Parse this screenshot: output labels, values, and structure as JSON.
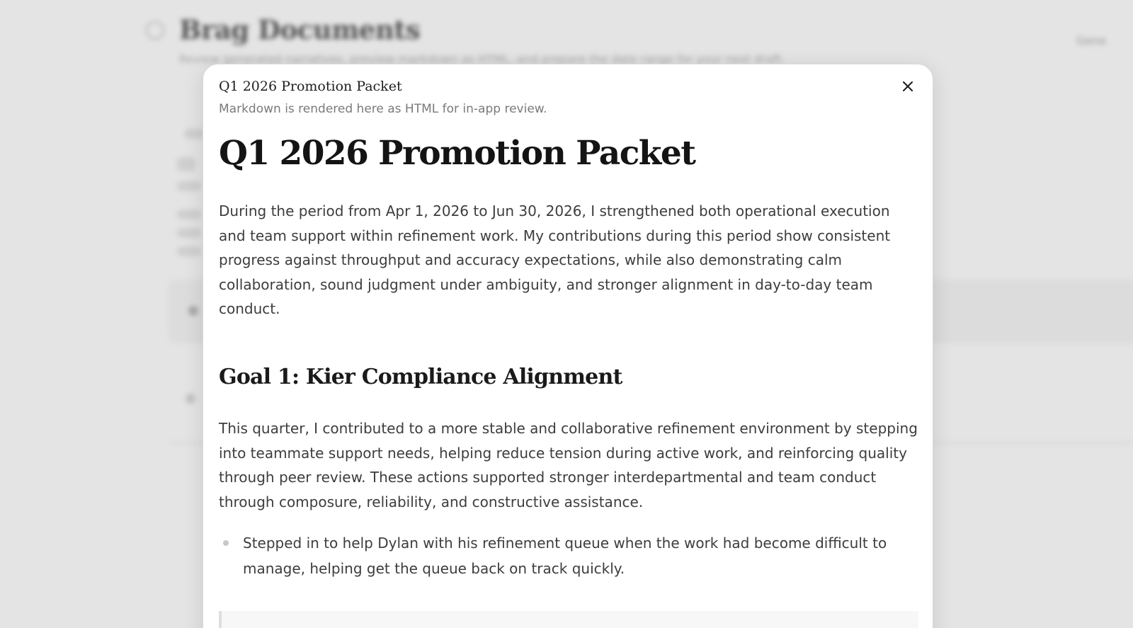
{
  "background": {
    "title": "Brag Documents",
    "subtitle": "Review generated narratives, preview markdown as HTML, and prepare the date range for your next draft.",
    "action_label": "Gene"
  },
  "modal": {
    "title": "Q1 2026 Promotion Packet",
    "subtitle": "Markdown is rendered here as HTML for in-app review.",
    "close_icon": "close-icon"
  },
  "document": {
    "title": "Q1 2026 Promotion Packet",
    "intro": "During the period from Apr 1, 2026 to Jun 30, 2026, I strengthened both operational execution and team support within refinement work. My contributions during this period show consistent progress against throughput and accuracy expectations, while also demonstrating calm collaboration, sound judgment under ambiguity, and stronger alignment in day-to-day team conduct.",
    "goals": [
      {
        "heading": "Goal 1: Kier Compliance Alignment",
        "paragraph": "This quarter, I contributed to a more stable and collaborative refinement environment by stepping into teammate support needs, helping reduce tension during active work, and reinforcing quality through peer review. These actions supported stronger interdepartmental and team conduct through composure, reliability, and constructive assistance.",
        "bullets": [
          "Stepped in to help Dylan with his refinement queue when the work had become difficult to manage, helping get the queue back on track quickly."
        ]
      }
    ]
  }
}
